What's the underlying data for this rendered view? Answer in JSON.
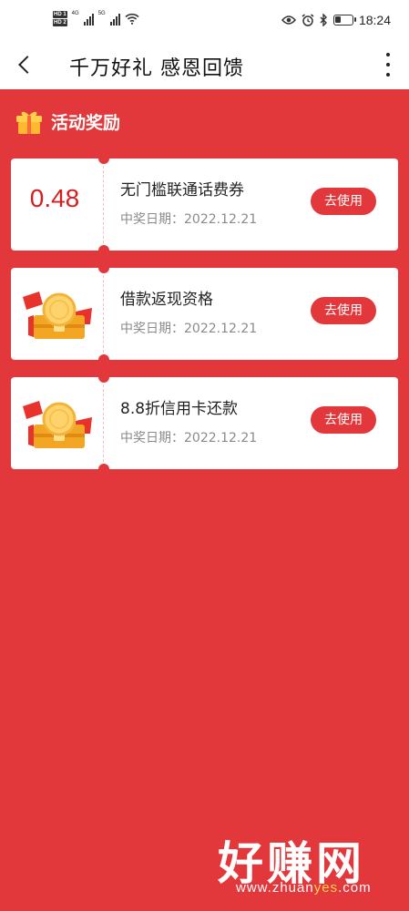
{
  "status_bar": {
    "hd1": "HD 1",
    "hd2": "HD 2",
    "net1": "4G",
    "net2": "5G",
    "time": "18:24",
    "battery_level": 0.35
  },
  "header": {
    "title": "千万好礼 感恩回馈"
  },
  "section": {
    "title": "活动奖励"
  },
  "rewards": [
    {
      "amount": "0.48",
      "name": "无门槛联通话费券",
      "date_label": "中奖日期：",
      "date": "2022.12.21",
      "button": "去使用"
    },
    {
      "amount": "",
      "name": "借款返现资格",
      "date_label": "中奖日期：",
      "date": "2022.12.21",
      "button": "去使用"
    },
    {
      "amount": "",
      "name": "8.8折信用卡还款",
      "date_label": "中奖日期：",
      "date": "2022.12.21",
      "button": "去使用"
    }
  ],
  "watermark": {
    "main": "好赚网",
    "url_pre": "www.zhuan",
    "url_hl": "yes",
    "url_post": ".com"
  },
  "colors": {
    "page_bg": "#e2383b",
    "amount": "#d32020",
    "button_bg": "#e2383b"
  }
}
